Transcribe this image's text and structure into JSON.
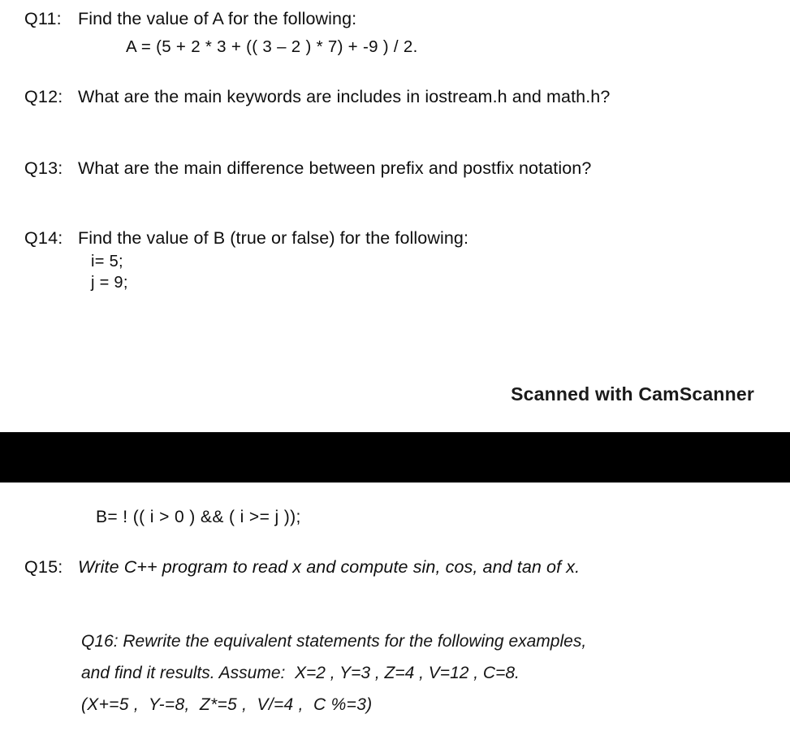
{
  "document": {
    "kind": "scanned-exam-questions",
    "background_color": "#ffffff",
    "text_color": "#0e0e0e",
    "separator_color": "#000000"
  },
  "questions": {
    "q11": {
      "label": "Q11:",
      "text": "Find the value of A for the following:",
      "formula": "A = (5 + 2 * 3 + (( 3 – 2 ) * 7) + -9 ) / 2."
    },
    "q12": {
      "label": "Q12:",
      "text": "What are the main keywords are includes in iostream.h and math.h?"
    },
    "q13": {
      "label": "Q13:",
      "text": "What are the main difference between prefix and postfix notation?"
    },
    "q14": {
      "label": "Q14:",
      "text": "Find the value of B (true or false) for the following:",
      "line_i": "i= 5;",
      "line_j": "j = 9;"
    },
    "q14_continued": {
      "expression": "B= ! (( i > 0 ) && ( i >= j ));"
    },
    "q15": {
      "label": "Q15:",
      "text": "Write C++ program to read x and compute sin, cos, and tan of x."
    },
    "q16": {
      "line1": "Q16: Rewrite the equivalent statements for the following examples,",
      "line2": "and find it results. Assume:  X=2 , Y=3 , Z=4 , V=12 , C=8.",
      "line3": "(X+=5 ,  Y-=8,  Z*=5 ,  V/=4 ,  C %=3)"
    }
  },
  "watermark": {
    "text": "Scanned with CamScanner"
  }
}
